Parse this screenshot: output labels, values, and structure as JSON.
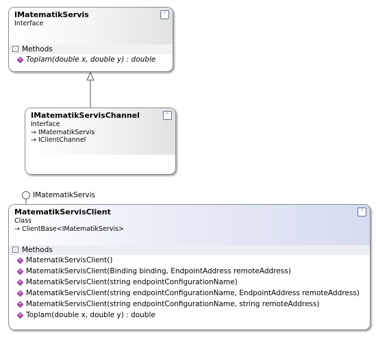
{
  "colors": {
    "method_icon": "#b24cb8",
    "border": "#8a8a8a",
    "class_header_tint": "#d6dcf0"
  },
  "matematik_interface": {
    "title": "IMatematikServis",
    "kind": "Interface",
    "collapse_glyph": "˄",
    "section_label": "Methods",
    "methods": [
      {
        "text": "Toplam(double x, double y) : double",
        "icon": "method-icon",
        "italic": true
      }
    ]
  },
  "channel_interface": {
    "title": "IMatematikServisChannel",
    "kind": "Interface",
    "collapse_glyph": "˄",
    "inherits": [
      "IMatematikServis",
      "IClientChannel"
    ]
  },
  "lollipop": {
    "label": "IMatematikServis"
  },
  "client_class": {
    "title": "MatematikServisClient",
    "kind": "Class",
    "collapse_glyph": "˄",
    "inherits": [
      "ClientBase<IMatematikServis>"
    ],
    "section_label": "Methods",
    "methods": [
      {
        "text": "MatematikServisClient()",
        "icon": "method-icon"
      },
      {
        "text": "MatematikServisClient(Binding binding, EndpointAddress remoteAddress)",
        "icon": "method-icon"
      },
      {
        "text": "MatematikServisClient(string endpointConfigurationName)",
        "icon": "method-icon"
      },
      {
        "text": "MatematikServisClient(string endpointConfigurationName, EndpointAddress remoteAddress)",
        "icon": "method-icon"
      },
      {
        "text": "MatematikServisClient(string endpointConfigurationName, string remoteAddress)",
        "icon": "method-icon"
      },
      {
        "text": "Toplam(double x, double y) : double",
        "icon": "method-icon"
      }
    ]
  }
}
